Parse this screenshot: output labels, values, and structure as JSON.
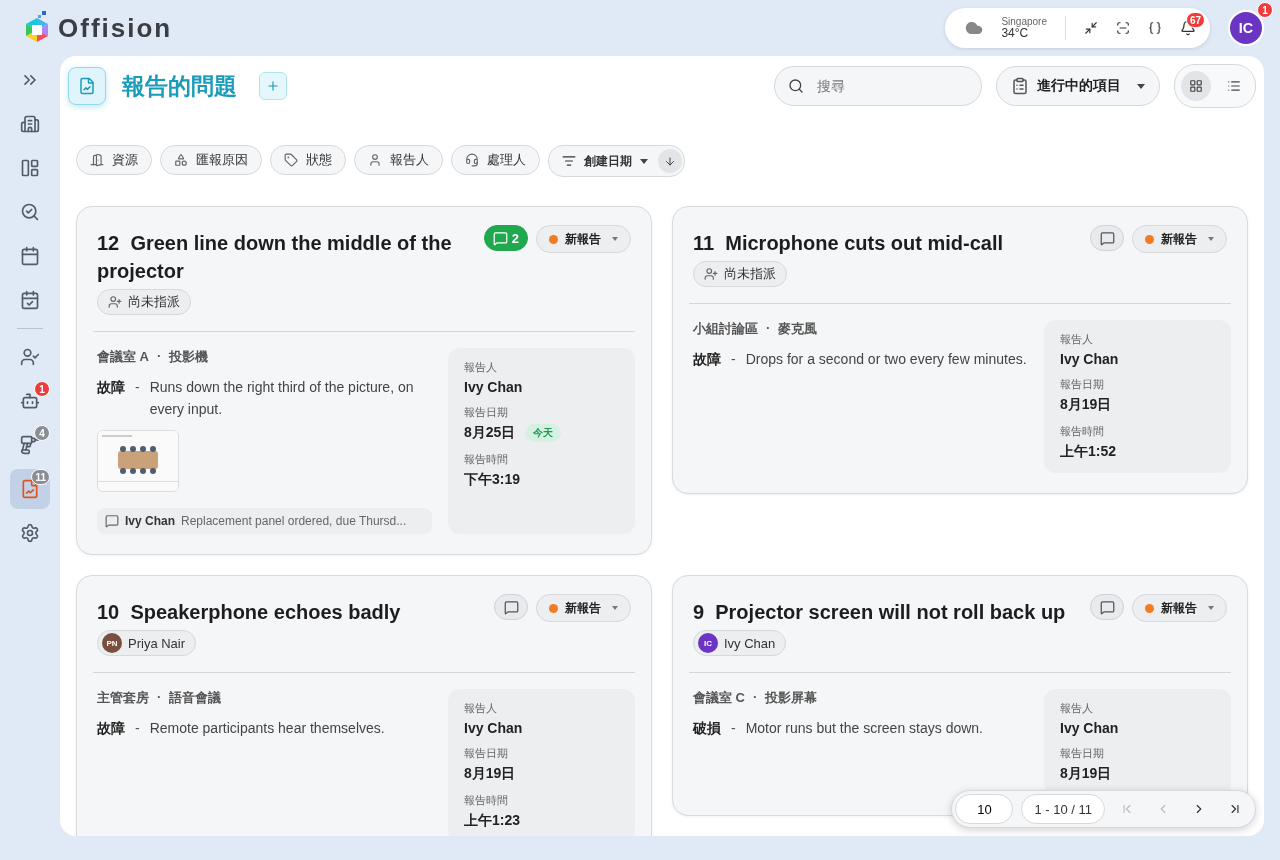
{
  "brand": {
    "name": "Offision"
  },
  "topbar": {
    "weather": {
      "city": "Singapore",
      "temperature": "34°C"
    },
    "notifications": "67",
    "user": {
      "initials": "IC",
      "badge": "1",
      "color": "#6a35c2"
    }
  },
  "sidebar": {
    "sections": [
      {
        "items": [
          {
            "kind": "expand",
            "selected": false
          },
          {
            "kind": "building",
            "selected": false
          },
          {
            "kind": "rooms",
            "selected": false
          },
          {
            "kind": "find",
            "selected": false
          },
          {
            "kind": "calendar",
            "selected": false
          },
          {
            "kind": "event",
            "selected": false
          }
        ]
      },
      {
        "items": [
          {
            "kind": "approve",
            "selected": false
          },
          {
            "kind": "bot",
            "selected": false,
            "badge": "1",
            "badge_alert": true
          },
          {
            "kind": "cleaning",
            "selected": false,
            "badge": "4",
            "badge_alert": false
          },
          {
            "kind": "reports",
            "selected": true,
            "badge": "11",
            "badge_alert": false
          },
          {
            "kind": "settings",
            "selected": false
          }
        ]
      }
    ]
  },
  "page": {
    "title": "報告的問題",
    "search": {
      "placeholder": "搜尋"
    },
    "scope": {
      "label": "進行中的項目"
    },
    "views": [
      {
        "kind": "grid",
        "selected": true
      },
      {
        "kind": "list",
        "selected": false
      }
    ]
  },
  "filters": [
    {
      "kind": "resource",
      "label": "資源"
    },
    {
      "kind": "reason",
      "label": "匯報原因"
    },
    {
      "kind": "status",
      "label": "狀態"
    },
    {
      "kind": "reporter",
      "label": "報告人"
    },
    {
      "kind": "handler",
      "label": "處理人"
    }
  ],
  "sort": {
    "label": "創建日期"
  },
  "cards": [
    {
      "number": "12",
      "title": "Green line down the middle of the projector",
      "comments": "2",
      "status": {
        "label": "新報告",
        "color": "#f47b20"
      },
      "assignee": {
        "kind": "unassigned",
        "label": "尚未指派"
      },
      "location": "會議室 A",
      "separator": "·",
      "equipment": "投影機",
      "category": "故障",
      "dash": "-",
      "description": "Runs down the right third of the picture, on every input.",
      "thumbnail": {
        "kind": "picture"
      },
      "latest_comment": {
        "author": "Ivy Chan",
        "text": "Replacement panel ordered, due Thursd..."
      },
      "info": [
        {
          "label": "報告人",
          "value": "Ivy Chan"
        },
        {
          "label": "報告日期",
          "value": "8月25日",
          "badge": "今天"
        },
        {
          "label": "報告時間",
          "value": "下午3:19"
        }
      ]
    },
    {
      "number": "11",
      "title": "Microphone cuts out mid-call",
      "status": {
        "label": "新報告",
        "color": "#f47b20"
      },
      "assignee": {
        "kind": "unassigned",
        "label": "尚未指派"
      },
      "location": "小組討論區",
      "separator": "·",
      "equipment": "麥克風",
      "category": "故障",
      "dash": "-",
      "description": "Drops for a second or two every few minutes.",
      "info": [
        {
          "label": "報告人",
          "value": "Ivy Chan"
        },
        {
          "label": "報告日期",
          "value": "8月19日"
        },
        {
          "label": "報告時間",
          "value": "上午1:52"
        }
      ]
    },
    {
      "number": "10",
      "title": "Speakerphone echoes badly",
      "status": {
        "label": "新報告",
        "color": "#f47b20"
      },
      "assignee": {
        "kind": "person",
        "initials": "PN",
        "label": "Priya Nair",
        "color": "#7a4f3f"
      },
      "location": "主管套房",
      "separator": "·",
      "equipment": "語音會議",
      "category": "故障",
      "dash": "-",
      "description": "Remote participants hear themselves.",
      "info": [
        {
          "label": "報告人",
          "value": "Ivy Chan"
        },
        {
          "label": "報告日期",
          "value": "8月19日"
        },
        {
          "label": "報告時間",
          "value": "上午1:23"
        }
      ]
    },
    {
      "number": "9",
      "title": "Projector screen will not roll back up",
      "status": {
        "label": "新報告",
        "color": "#f47b20"
      },
      "assignee": {
        "kind": "person",
        "initials": "IC",
        "label": "Ivy Chan",
        "color": "#6a35c2"
      },
      "location": "會議室 C",
      "separator": "·",
      "equipment": "投影屏幕",
      "category": "破損",
      "dash": "-",
      "description": "Motor runs but the screen stays down.",
      "info": [
        {
          "label": "報告人",
          "value": "Ivy Chan"
        },
        {
          "label": "報告日期",
          "value": "8月19日"
        }
      ]
    }
  ],
  "pagination": {
    "page_size": "10",
    "range": "1 - 10 / 11"
  }
}
